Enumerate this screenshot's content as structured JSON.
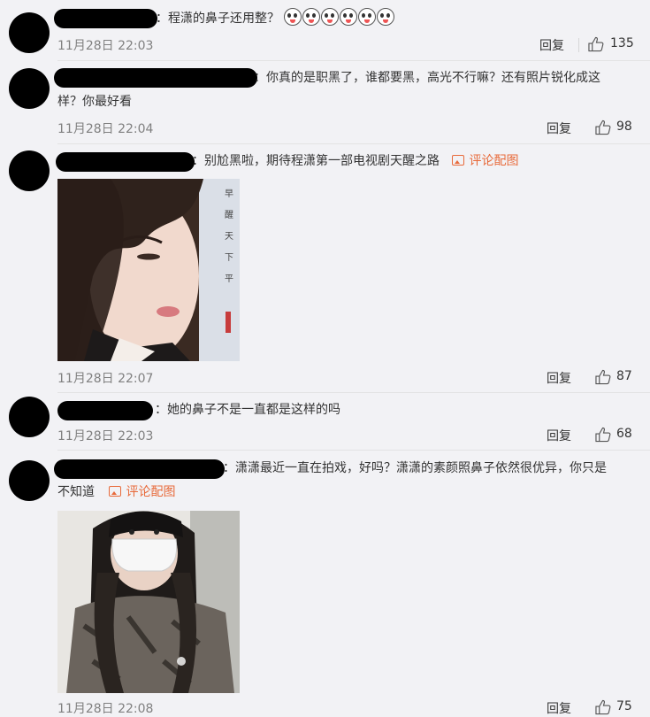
{
  "comments": [
    {
      "text": "：程潇的鼻子还用整？",
      "emoji_count": 6,
      "time": "11月28日 22:03",
      "reply": "回复",
      "likes": "135"
    },
    {
      "text_line1": "：你真的是职黑了，谁都要黑，高光不行嘛？还有照片锐化成这",
      "text_line2": "样？你最好看",
      "time": "11月28日 22:04",
      "reply": "回复",
      "likes": "98"
    },
    {
      "text": "：别尬黑啦，期待程潇第一部电视剧天醒之路",
      "pic_link": "评论配图",
      "image_text": [
        "早",
        "醒",
        "天",
        "下",
        "平"
      ],
      "time": "11月28日 22:07",
      "reply": "回复",
      "likes": "87"
    },
    {
      "text": "：她的鼻子不是一直都是这样的吗",
      "time": "11月28日 22:03",
      "reply": "回复",
      "likes": "68"
    },
    {
      "text_line1": "：潇潇最近一直在拍戏，好吗？潇潇的素颜照鼻子依然很优异，你只是",
      "text_line2": "不知道",
      "pic_link": "评论配图",
      "time": "11月28日 22:08",
      "reply": "回复",
      "likes": "75"
    }
  ],
  "icons": {
    "like": "thumbs-up-icon",
    "image": "image-icon",
    "emoji": "emoji-icon"
  },
  "colors": {
    "background": "#f2f2f5",
    "link": "#e86a3a",
    "time": "#808080"
  }
}
